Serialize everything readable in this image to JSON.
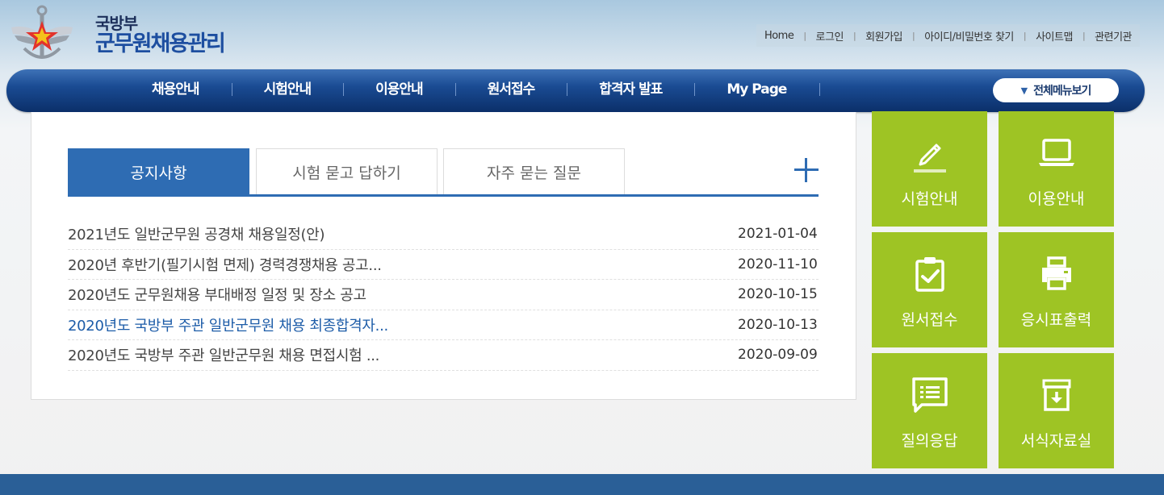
{
  "header": {
    "logo_small": "국방부",
    "logo_big": "군무원채용관리",
    "util_links": [
      "Home",
      "로그인",
      "회원가입",
      "아이디/비밀번호 찾기",
      "사이트맵",
      "관련기관"
    ]
  },
  "nav": {
    "items": [
      "채용안내",
      "시험안내",
      "이용안내",
      "원서접수",
      "합격자 발표",
      "My Page"
    ],
    "all_menu": "전체메뉴보기"
  },
  "tabs": {
    "items": [
      "공지사항",
      "시험 묻고 답하기",
      "자주 묻는 질문"
    ],
    "active_index": 0
  },
  "notices": [
    {
      "title": "2021년도 일반군무원 공경채 채용일정(안)",
      "date": "2021-01-04"
    },
    {
      "title": "2020년 후반기(필기시험 면제) 경력경쟁채용 공고...",
      "date": "2020-11-10"
    },
    {
      "title": "2020년도 군무원채용 부대배정 일정 및 장소 공고",
      "date": "2020-10-15"
    },
    {
      "title": "2020년도 국방부 주관 일반군무원 채용 최종합격자...",
      "date": "2020-10-13"
    },
    {
      "title": "2020년도 국방부 주관 일반군무원 채용 면접시험 ...",
      "date": "2020-09-09"
    }
  ],
  "quick_menu": [
    {
      "label": "시험안내",
      "icon": "pencil-icon"
    },
    {
      "label": "이용안내",
      "icon": "laptop-icon"
    },
    {
      "label": "원서접수",
      "icon": "clipboard-check-icon"
    },
    {
      "label": "응시표출력",
      "icon": "printer-icon"
    },
    {
      "label": "질의응답",
      "icon": "chat-list-icon"
    },
    {
      "label": "서식자료실",
      "icon": "download-box-icon"
    }
  ],
  "colors": {
    "nav_blue": "#1a4b93",
    "tab_blue": "#2e6cb3",
    "tile_green": "#9ec424",
    "highlight_link": "#1d5ca8",
    "footer_blue": "#2a5f97"
  }
}
